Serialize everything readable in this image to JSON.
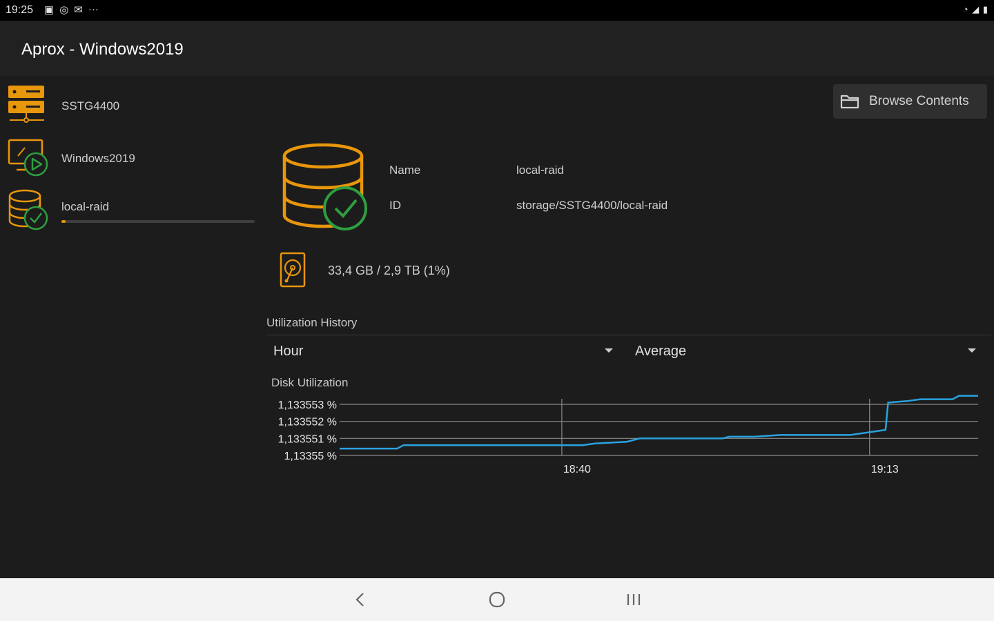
{
  "status_bar": {
    "time": "19:25",
    "icons": [
      "image-icon",
      "sync-icon",
      "mail-icon",
      "more-icon"
    ]
  },
  "app": {
    "title": "Aprox - Windows2019"
  },
  "sidebar": {
    "items": [
      {
        "label": "SSTG4400",
        "icon": "server-icon"
      },
      {
        "label": "Windows2019",
        "icon": "vm-running-icon"
      },
      {
        "label": "local-raid",
        "icon": "storage-ok-icon",
        "usage_fraction": 0.02
      }
    ]
  },
  "toolbar": {
    "browse_label": "Browse Contents"
  },
  "storage": {
    "name_label": "Name",
    "name_value": "local-raid",
    "id_label": "ID",
    "id_value": "storage/SSTG4400/local-raid",
    "usage_text": "33,4 GB / 2,9 TB (1%)"
  },
  "history": {
    "section_title": "Utilization History",
    "timeframe": "Hour",
    "aggregation": "Average",
    "chart_title": "Disk Utilization"
  },
  "chart_data": {
    "type": "line",
    "title": "Disk Utilization",
    "y_tick_labels": [
      "1,133553 %",
      "1,133552 %",
      "1,133551 %",
      "1,13355 %"
    ],
    "y_ticks": [
      1.133553,
      1.133552,
      1.133551,
      1.13355
    ],
    "ylim": [
      1.13355,
      1.133553
    ],
    "x_tick_labels": [
      "18:40",
      "19:13"
    ],
    "grid": true,
    "color": "#29a3e0",
    "series": [
      {
        "x": [
          0,
          0.09,
          0.1,
          0.38,
          0.4,
          0.45,
          0.47,
          0.49,
          0.6,
          0.61,
          0.65,
          0.69,
          0.8,
          0.855,
          0.859,
          0.89,
          0.91,
          0.96,
          0.97,
          1.0
        ],
        "y": [
          1.1335504,
          1.1335504,
          1.1335506,
          1.1335506,
          1.1335507,
          1.1335508,
          1.133551,
          1.133551,
          1.133551,
          1.1335511,
          1.1335511,
          1.1335512,
          1.1335512,
          1.1335515,
          1.1335531,
          1.1335532,
          1.1335533,
          1.1335533,
          1.1335535,
          1.1335535
        ]
      }
    ]
  },
  "colors": {
    "accent": "#e8960c",
    "ok": "#2e9e40",
    "chart_line": "#29a3e0",
    "background": "#1c1c1c"
  }
}
